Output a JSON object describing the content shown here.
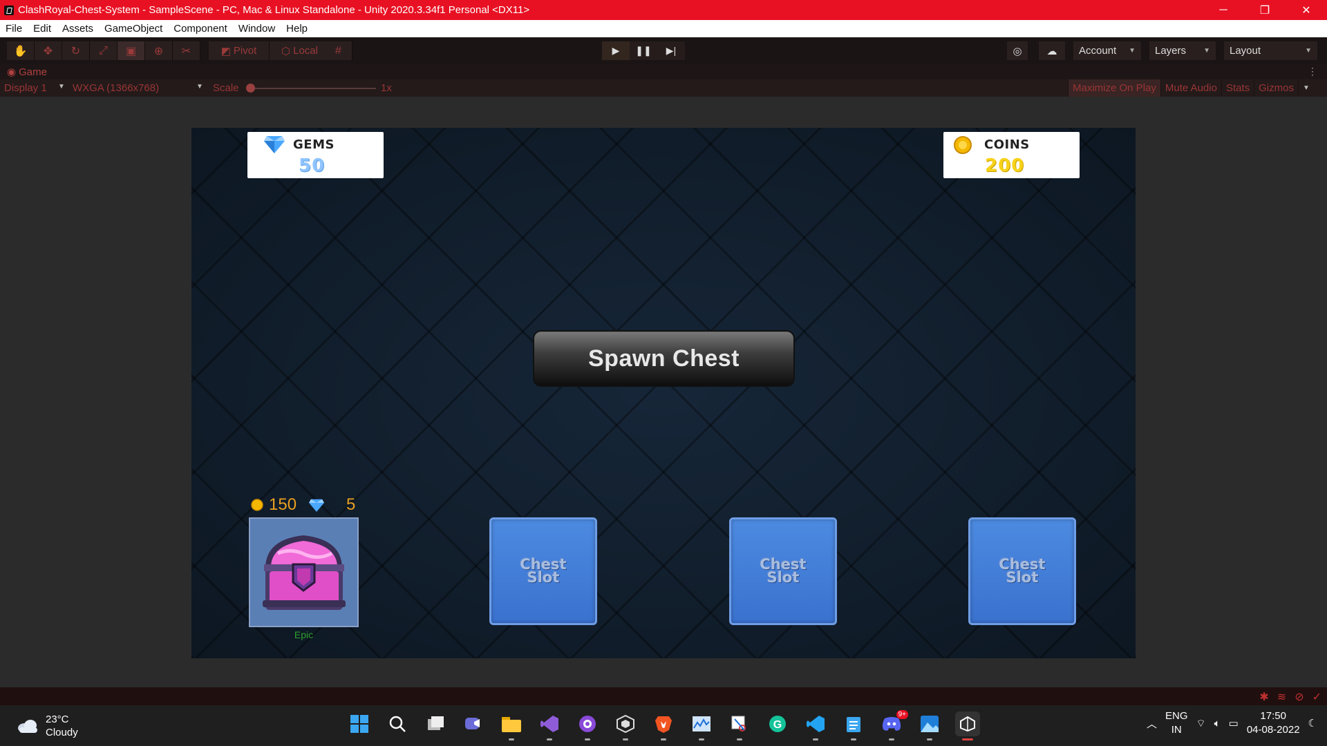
{
  "window": {
    "title": "ClashRoyal-Chest-System - SampleScene - PC, Mac & Linux Standalone - Unity 2020.3.34f1 Personal <DX11>",
    "minimize": "─",
    "restore": "❐",
    "close": "✕"
  },
  "menu": [
    "File",
    "Edit",
    "Assets",
    "GameObject",
    "Component",
    "Window",
    "Help"
  ],
  "toolbar": {
    "pivot": "Pivot",
    "local": "Local",
    "account": "Account",
    "layers": "Layers",
    "layout": "Layout"
  },
  "game_view": {
    "tab": "Game",
    "display": "Display 1",
    "resolution": "WXGA (1366x768)",
    "scale_label": "Scale",
    "scale_value": "1x",
    "maximize_on_play": "Maximize On Play",
    "mute_audio": "Mute Audio",
    "stats": "Stats",
    "gizmos": "Gizmos"
  },
  "game": {
    "gems": {
      "label": "GEMS",
      "value": "50"
    },
    "coins": {
      "label": "COINS",
      "value": "200"
    },
    "spawn_button": "Spawn Chest",
    "chest": {
      "coin_cost": "150",
      "gem_cost": "5",
      "type": "Epic"
    },
    "slots": [
      {
        "line1": "Chest",
        "line2": "Slot"
      },
      {
        "line1": "Chest",
        "line2": "Slot"
      },
      {
        "line1": "Chest",
        "line2": "Slot"
      }
    ]
  },
  "taskbar": {
    "weather_temp": "23°C",
    "weather_desc": "Cloudy",
    "lang_1": "ENG",
    "lang_2": "IN",
    "time": "17:50",
    "date": "04-08-2022",
    "discord_badge": "9+"
  },
  "colors": {
    "titlebar": "#e81123",
    "gems_value": "#8fc4ff",
    "coins_value": "#f7d21a",
    "slot_blue": "#3f7bd8",
    "chest_type": "#2ca12c"
  }
}
